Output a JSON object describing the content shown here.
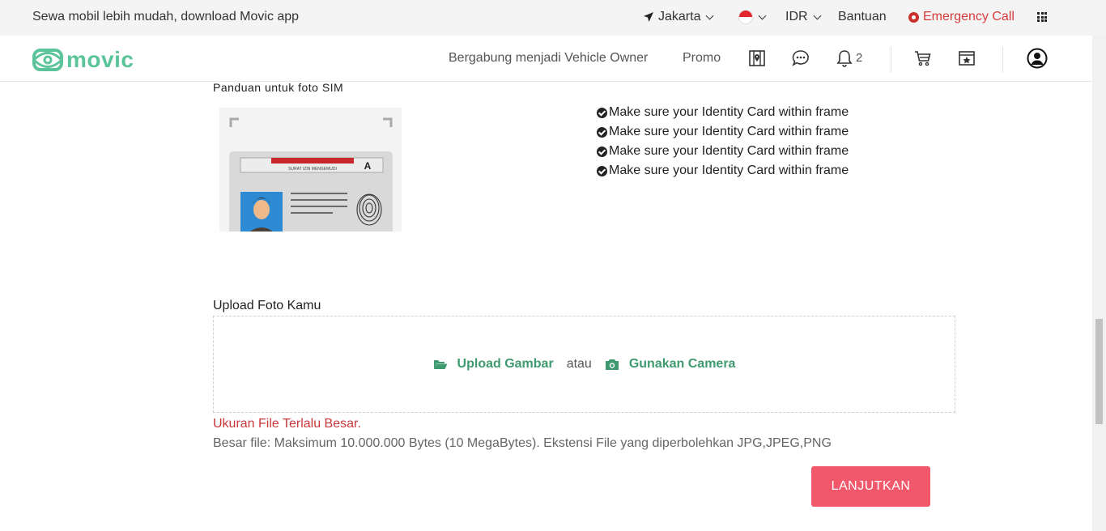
{
  "topbar": {
    "promo_text": "Sewa mobil lebih mudah, download Movic app",
    "city": "Jakarta",
    "currency": "IDR",
    "help": "Bantuan",
    "emergency": "Emergency Call"
  },
  "navbar": {
    "logo_text": "movic",
    "join_owner": "Bergabung menjadi Vehicle Owner",
    "promo": "Promo",
    "notification_count": "2"
  },
  "guide": {
    "title": "Panduan untuk foto SIM",
    "card_header": "SURAT IZIN MENGEMUDI",
    "card_class": "A",
    "checks": [
      "Make sure your Identity Card within frame",
      "Make sure your Identity Card within frame",
      "Make sure your Identity Card within frame",
      "Make sure your Identity Card within frame"
    ]
  },
  "upload": {
    "label": "Upload Foto Kamu",
    "upload_image": "Upload Gambar",
    "or": "atau",
    "use_camera": "Gunakan Camera",
    "error": "Ukuran File Terlalu Besar.",
    "hint": "Besar file: Maksimum 10.000.000 Bytes (10 MegaBytes). Ekstensi File yang diperbolehkan JPG,JPEG,PNG"
  },
  "actions": {
    "continue": "LANJUTKAN"
  },
  "colors": {
    "brand": "#5cc49a",
    "link_green": "#3f9a6f",
    "error_red": "#c9363b",
    "button": "#f2586c"
  }
}
